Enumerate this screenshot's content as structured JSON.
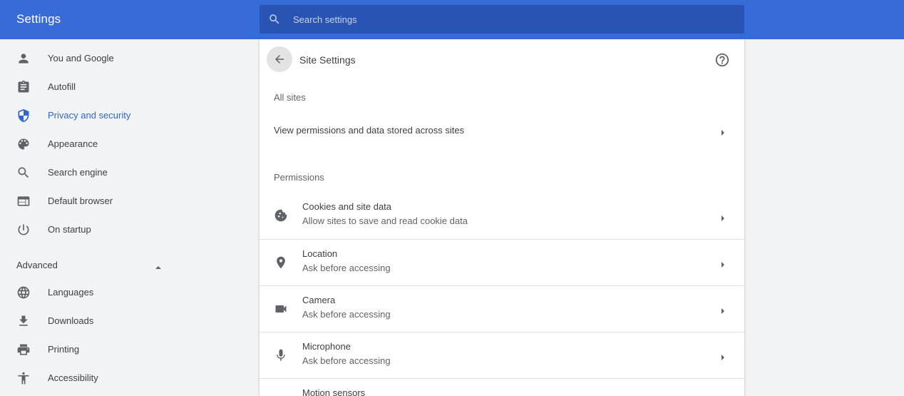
{
  "header": {
    "title": "Settings",
    "search_placeholder": "Search settings",
    "search_value": "",
    "bar_color": "#366bd8"
  },
  "sidebar": {
    "items": [
      {
        "label": "You and Google",
        "icon": "person-icon"
      },
      {
        "label": "Autofill",
        "icon": "clipboard-icon"
      },
      {
        "label": "Privacy and security",
        "icon": "shield-icon",
        "active": true
      },
      {
        "label": "Appearance",
        "icon": "palette-icon"
      },
      {
        "label": "Search engine",
        "icon": "search-icon"
      },
      {
        "label": "Default browser",
        "icon": "browser-icon"
      },
      {
        "label": "On startup",
        "icon": "power-icon"
      }
    ],
    "advanced_label": "Advanced",
    "advanced_items": [
      {
        "label": "Languages",
        "icon": "globe-icon"
      },
      {
        "label": "Downloads",
        "icon": "download-icon"
      },
      {
        "label": "Printing",
        "icon": "printer-icon"
      },
      {
        "label": "Accessibility",
        "icon": "accessibility-icon"
      }
    ]
  },
  "main": {
    "title": "Site Settings",
    "all_sites_heading": "All sites",
    "all_sites_row": "View permissions and data stored across sites",
    "permissions_heading": "Permissions",
    "permissions": [
      {
        "title": "Cookies and site data",
        "subtitle": "Allow sites to save and read cookie data",
        "icon": "cookie-icon"
      },
      {
        "title": "Location",
        "subtitle": "Ask before accessing",
        "icon": "location-pin-icon"
      },
      {
        "title": "Camera",
        "subtitle": "Ask before accessing",
        "icon": "camera-icon"
      },
      {
        "title": "Microphone",
        "subtitle": "Ask before accessing",
        "icon": "microphone-icon"
      },
      {
        "title": "Motion sensors",
        "subtitle": "",
        "icon": "motion-sensor-icon"
      }
    ]
  },
  "colors": {
    "accent": "#3366cc",
    "icon_gray": "#5f6368"
  }
}
